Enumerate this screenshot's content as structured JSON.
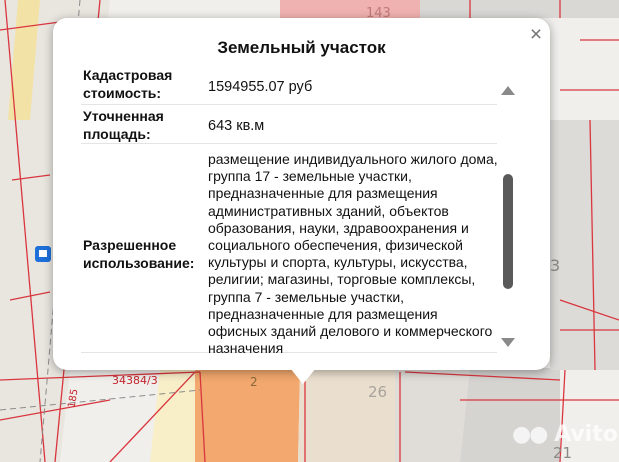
{
  "popup": {
    "title": "Земельный участок",
    "close_symbol": "×",
    "rows": [
      {
        "label": "Кадастровая стоимость:",
        "value": "1594955.07 руб"
      },
      {
        "label": "Уточненная площадь:",
        "value": "643 кв.м"
      },
      {
        "label": "Разрешенное использование:",
        "value": "размещение индивидуального жилого дома, группа 17 - земельные участки, предназначенные для размещения административных зданий, объектов образования, науки, здравоохранения и социального обеспечения, физической культуры и спорта, культуры, искусства, религии; магазины, торговые комплексы, группа 7 - земельные участки, предназначенные для размещения офисных зданий делового и коммерческого назначения"
      }
    ]
  },
  "map": {
    "parcel_label": "34384/3",
    "road_label": "185",
    "number_2": "2",
    "number_26": "26",
    "number_21": "21",
    "number_3": "3",
    "number_top": "143",
    "watermark": "Avito"
  }
}
